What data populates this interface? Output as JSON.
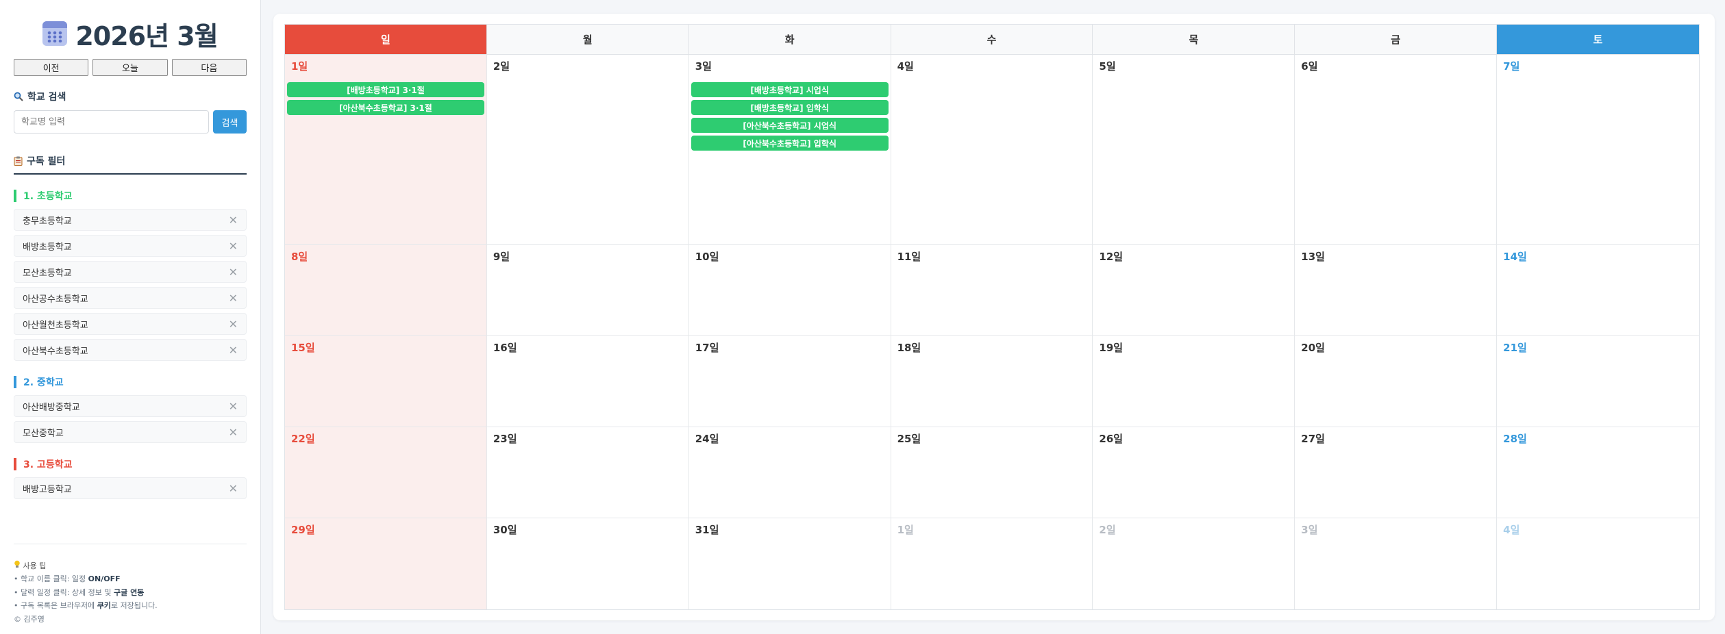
{
  "header": {
    "title": "2026년 3월",
    "icon": "calendar-icon"
  },
  "nav": {
    "prev": "이전",
    "today": "오늘",
    "next": "다음"
  },
  "search": {
    "title": "학교 검색",
    "placeholder": "학교명 입력",
    "button": "검색",
    "icon": "magnifier-icon"
  },
  "filter": {
    "title": "구독 필터",
    "icon": "clipboard-icon",
    "groups": [
      {
        "title": "1. 초등학교",
        "color": "#2ecc71",
        "schools": [
          "충무초등학교",
          "배방초등학교",
          "모산초등학교",
          "아산공수초등학교",
          "아산월천초등학교",
          "아산북수초등학교"
        ]
      },
      {
        "title": "2. 중학교",
        "color": "#3498db",
        "schools": [
          "아산배방중학교",
          "모산중학교"
        ]
      },
      {
        "title": "3. 고등학교",
        "color": "#e74c3c",
        "schools": [
          "배방고등학교"
        ]
      }
    ]
  },
  "tips": {
    "title": "사용 팁",
    "icon": "lightbulb-icon",
    "line1_pre": "• 학교 이름 클릭: 일정 ",
    "line1_bold": "ON/OFF",
    "line2_pre": "• 달력 일정 클릭: 상세 정보 및 ",
    "line2_bold": "구글 연동",
    "line3_pre": "• 구독 목록은 브라우저에 ",
    "line3_bold": "쿠키",
    "line3_post": "로 저장됩니다.",
    "copyright": "© 김주영"
  },
  "calendar": {
    "weekdays": [
      "일",
      "월",
      "화",
      "수",
      "목",
      "금",
      "토"
    ],
    "weeks": [
      [
        {
          "label": "1일",
          "events": [
            "[배방초등학교] 3·1절",
            "[아산북수초등학교] 3·1절"
          ]
        },
        {
          "label": "2일"
        },
        {
          "label": "3일",
          "events": [
            "[배방초등학교] 시업식",
            "[배방초등학교] 입학식",
            "[아산북수초등학교] 시업식",
            "[아산북수초등학교] 입학식"
          ]
        },
        {
          "label": "4일"
        },
        {
          "label": "5일"
        },
        {
          "label": "6일"
        },
        {
          "label": "7일"
        }
      ],
      [
        {
          "label": "8일"
        },
        {
          "label": "9일"
        },
        {
          "label": "10일"
        },
        {
          "label": "11일"
        },
        {
          "label": "12일"
        },
        {
          "label": "13일"
        },
        {
          "label": "14일"
        }
      ],
      [
        {
          "label": "15일"
        },
        {
          "label": "16일"
        },
        {
          "label": "17일"
        },
        {
          "label": "18일"
        },
        {
          "label": "19일"
        },
        {
          "label": "20일"
        },
        {
          "label": "21일"
        }
      ],
      [
        {
          "label": "22일"
        },
        {
          "label": "23일"
        },
        {
          "label": "24일"
        },
        {
          "label": "25일"
        },
        {
          "label": "26일"
        },
        {
          "label": "27일"
        },
        {
          "label": "28일"
        }
      ],
      [
        {
          "label": "29일"
        },
        {
          "label": "30일"
        },
        {
          "label": "31일"
        },
        {
          "label": "1일",
          "other": true
        },
        {
          "label": "2일",
          "other": true
        },
        {
          "label": "3일",
          "other": true
        },
        {
          "label": "4일",
          "other": true
        }
      ]
    ],
    "colors": {
      "sunday": "#e74c3c",
      "saturday": "#3498db",
      "event": "#2ecc71"
    }
  }
}
